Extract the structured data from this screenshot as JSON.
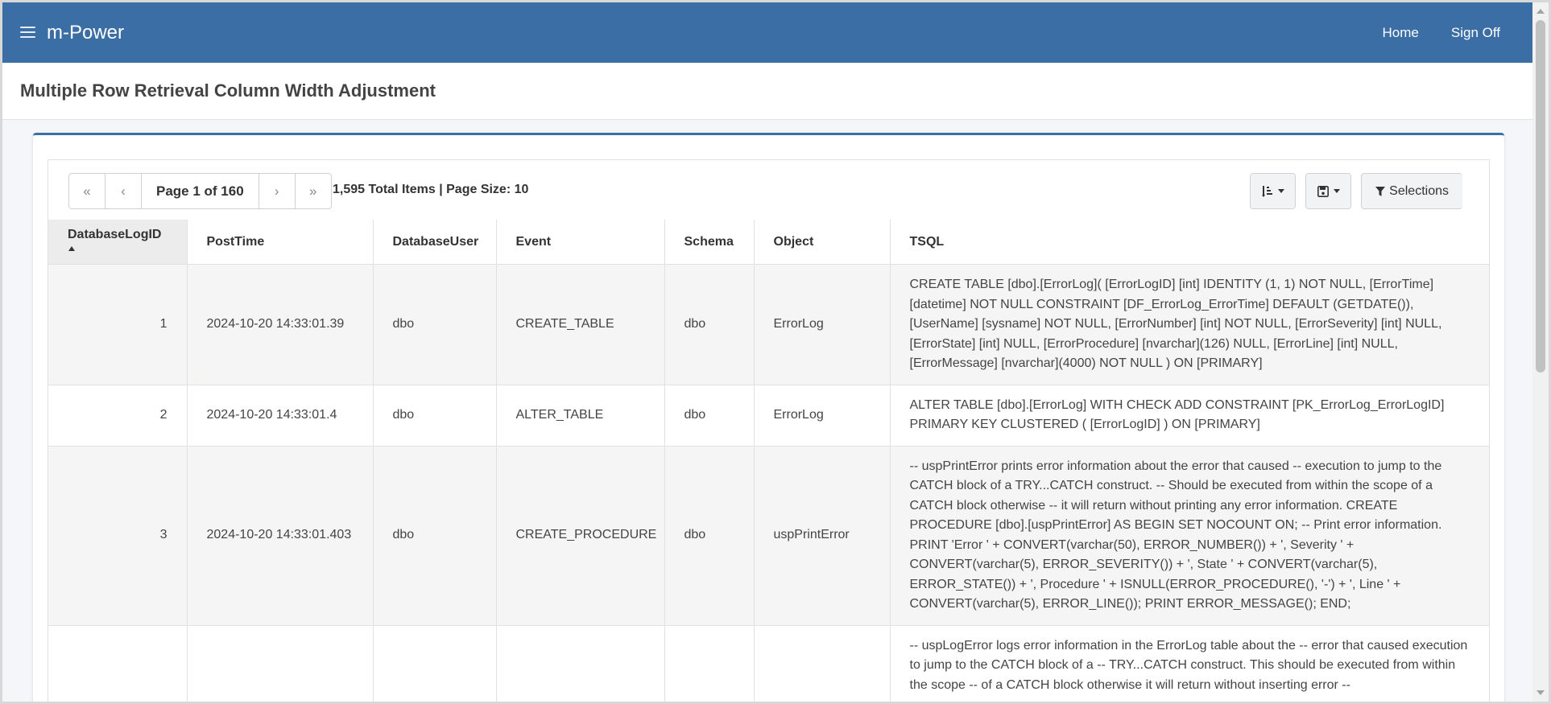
{
  "header": {
    "brand": "m-Power",
    "nav": [
      {
        "label": "Home"
      },
      {
        "label": "Sign Off"
      }
    ]
  },
  "page": {
    "title": "Multiple Row Retrieval Column Width Adjustment"
  },
  "pager": {
    "first": "«",
    "prev": "‹",
    "label": "Page 1 of 160",
    "next": "›",
    "last": "»",
    "totals": "1,595 Total Items | Page Size: 10"
  },
  "tools": {
    "sort_icon": "sort-icon",
    "save_icon": "save-icon",
    "selections_label": "Selections"
  },
  "table": {
    "columns": [
      "DatabaseLogID",
      "PostTime",
      "DatabaseUser",
      "Event",
      "Schema",
      "Object",
      "TSQL"
    ],
    "sorted_column": "DatabaseLogID",
    "sort_direction": "ascending",
    "rows": [
      {
        "id": "1",
        "posttime": "2024-10-20 14:33:01.39",
        "user": "dbo",
        "event": "CREATE_TABLE",
        "schema": "dbo",
        "object": "ErrorLog",
        "tsql": "CREATE TABLE [dbo].[ErrorLog]( [ErrorLogID] [int] IDENTITY (1, 1) NOT NULL, [ErrorTime] [datetime] NOT NULL CONSTRAINT [DF_ErrorLog_ErrorTime] DEFAULT (GETDATE()), [UserName] [sysname] NOT NULL, [ErrorNumber] [int] NOT NULL, [ErrorSeverity] [int] NULL, [ErrorState] [int] NULL, [ErrorProcedure] [nvarchar](126) NULL, [ErrorLine] [int] NULL, [ErrorMessage] [nvarchar](4000) NOT NULL ) ON [PRIMARY]"
      },
      {
        "id": "2",
        "posttime": "2024-10-20 14:33:01.4",
        "user": "dbo",
        "event": "ALTER_TABLE",
        "schema": "dbo",
        "object": "ErrorLog",
        "tsql": "ALTER TABLE [dbo].[ErrorLog] WITH CHECK ADD CONSTRAINT [PK_ErrorLog_ErrorLogID] PRIMARY KEY CLUSTERED ( [ErrorLogID] ) ON [PRIMARY]"
      },
      {
        "id": "3",
        "posttime": "2024-10-20 14:33:01.403",
        "user": "dbo",
        "event": "CREATE_PROCEDURE",
        "schema": "dbo",
        "object": "uspPrintError",
        "tsql": "-- uspPrintError prints error information about the error that caused -- execution to jump to the CATCH block of a TRY...CATCH construct. -- Should be executed from within the scope of a CATCH block otherwise -- it will return without printing any error information. CREATE PROCEDURE [dbo].[uspPrintError] AS BEGIN SET NOCOUNT ON; -- Print error information. PRINT 'Error ' + CONVERT(varchar(50), ERROR_NUMBER()) + ', Severity ' + CONVERT(varchar(5), ERROR_SEVERITY()) + ', State ' + CONVERT(varchar(5), ERROR_STATE()) + ', Procedure ' + ISNULL(ERROR_PROCEDURE(), '-') + ', Line ' + CONVERT(varchar(5), ERROR_LINE()); PRINT ERROR_MESSAGE(); END;"
      },
      {
        "id": "",
        "posttime": "",
        "user": "",
        "event": "",
        "schema": "",
        "object": "",
        "tsql": "-- uspLogError logs error information in the ErrorLog table about the -- error that caused execution to jump to the CATCH block of a -- TRY...CATCH construct. This should be executed from within the scope -- of a CATCH block otherwise it will return without inserting error --"
      }
    ]
  },
  "colors": {
    "header_bg": "#3a6ea5",
    "card_accent": "#3a6ea5",
    "stripe": "#f5f5f5",
    "sorted_header_bg": "#ececec"
  }
}
